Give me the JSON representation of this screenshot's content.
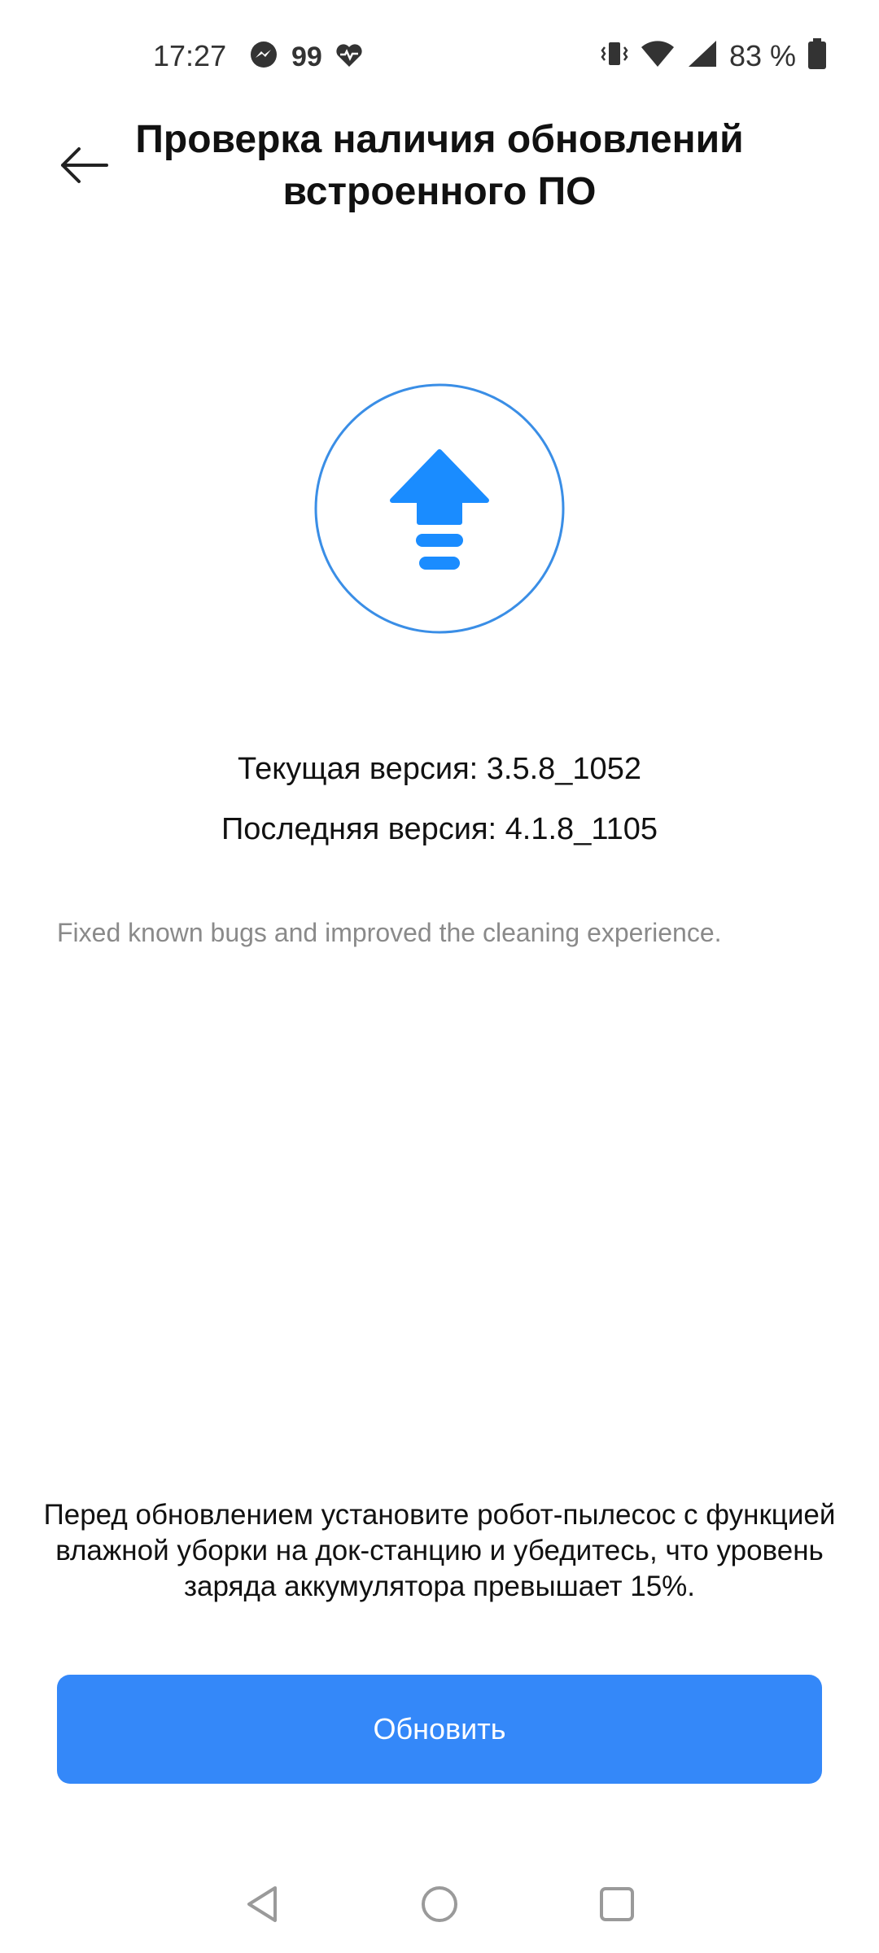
{
  "status_bar": {
    "time": "17:27",
    "notification_count": "99",
    "battery_percent": "83 %",
    "icons": [
      "messenger-icon",
      "heart-rate-icon",
      "vibrate-icon",
      "wifi-icon",
      "signal-icon",
      "battery-icon"
    ]
  },
  "header": {
    "title": "Проверка наличия обновлений встроенного ПО",
    "back_icon": "arrow-left-icon"
  },
  "hero": {
    "icon": "firmware-upgrade-icon",
    "accent_color": "#1a8cff",
    "ring_color": "#3a8ee6"
  },
  "versions": {
    "current": "Текущая версия: 3.5.8_1052",
    "latest": "Последняя версия: 4.1.8_1105"
  },
  "release_notes": "Fixed known bugs and improved the cleaning experience.",
  "warning": "Перед обновлением установите робот-пылесос с функцией влажной уборки на док-станцию и убедитесь, что уровень заряда аккумулятора превышает 15%.",
  "update_button": {
    "label": "Обновить",
    "color": "#3488f9"
  },
  "nav_bar": {
    "icons": [
      "back-triangle-icon",
      "home-circle-icon",
      "recents-square-icon"
    ]
  }
}
